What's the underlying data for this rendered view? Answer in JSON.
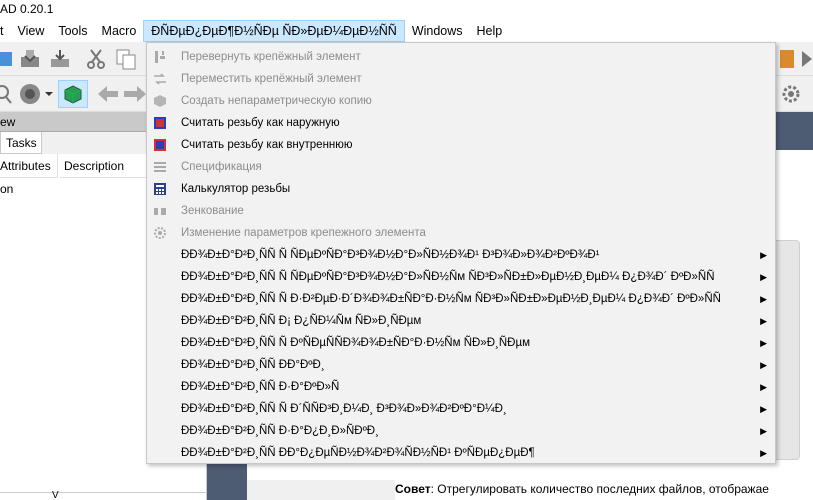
{
  "window": {
    "title": "AD 0.20.1"
  },
  "menubar": {
    "items": [
      {
        "label": "t"
      },
      {
        "label": "View"
      },
      {
        "label": "Tools"
      },
      {
        "label": "Macro"
      },
      {
        "label": "ÐÑÐµÐ¿ÐµÐ¶Ð½ÑÐµ ÑÐ»ÐµÐ¼ÐµÐ½ÑÑ",
        "active": true
      },
      {
        "label": "Windows"
      },
      {
        "label": "Help"
      }
    ]
  },
  "left_panel": {
    "header": "ew",
    "tab": "Tasks",
    "columns": [
      "Attributes",
      "Description"
    ],
    "row1": "on",
    "bottom_col": "V"
  },
  "dropdown": {
    "items": [
      {
        "label": "Перевернуть крепёжный элемент",
        "disabled": true,
        "icon": "flip-icon"
      },
      {
        "label": "Переместить крепёжный элемент",
        "disabled": true,
        "icon": "move-icon"
      },
      {
        "label": "Создать непараметрическую копию",
        "disabled": true,
        "icon": "copy-icon"
      },
      {
        "label": "Считать резьбу как наружную",
        "disabled": false,
        "icon": "thread-outer-icon"
      },
      {
        "label": "Считать резьбу как внутреннюю",
        "disabled": false,
        "icon": "thread-inner-icon"
      },
      {
        "label": "Спецификация",
        "disabled": true,
        "icon": "list-icon"
      },
      {
        "label": "Калькулятор резьбы",
        "disabled": false,
        "icon": "calculator-icon"
      },
      {
        "label": "Зенкование",
        "disabled": true,
        "icon": "countersink-icon"
      },
      {
        "label": "Изменение параметров крепежного элемента",
        "disabled": true,
        "icon": "gear-icon"
      },
      {
        "label": "ÐÐ¾Ð±Ð°Ð²Ð¸ÑÑ Ñ ÑÐµÐºÑÐ°Ð³Ð¾Ð½Ð°Ð»ÑÐ½Ð¾Ð¹ Ð³Ð¾Ð»Ð¾Ð²ÐºÐ¾Ð¹",
        "submenu": true
      },
      {
        "label": "ÐÐ¾Ð±Ð°Ð²Ð¸ÑÑ Ñ ÑÐµÐºÑÐ°Ð³Ð¾Ð½Ð°Ð»ÑÐ½Ñм ÑÐ³Ð»ÑÐ±Ð»ÐµÐ½Ð¸ÐµÐ¼ Ð¿Ð¾Ð´ ÐºÐ»ÑÑ",
        "submenu": true
      },
      {
        "label": "ÐÐ¾Ð±Ð°Ð²Ð¸ÑÑ Ñ Ð·Ð²ÐµÐ·Ð´Ð¾Ð¾Ð±ÑÐ°Ð·Ð½Ñм ÑÐ³Ð»ÑÐ±Ð»ÐµÐ½Ð¸ÐµÐ¼ Ð¿Ð¾Ð´ ÐºÐ»ÑÑ",
        "submenu": true
      },
      {
        "label": "ÐÐ¾Ð±Ð°Ð²Ð¸ÑÑ Ð¡ Ð¿ÑÐ¼Ñм ÑÐ»Ð¸ÑÐµм",
        "submenu": true
      },
      {
        "label": "ÐÐ¾Ð±Ð°Ð²Ð¸ÑÑ Ñ ÐºÑÐµÑÑÐ¾Ð¾Ð±ÑÐ°Ð·Ð½Ñм ÑÐ»Ð¸ÑÐµм",
        "submenu": true
      },
      {
        "label": "ÐÐ¾Ð±Ð°Ð²Ð¸ÑÑ ÐÐ°ÐºÐ¸",
        "submenu": true
      },
      {
        "label": "ÐÐ¾Ð±Ð°Ð²Ð¸ÑÑ Ð·Ð°ÐºÐ»Ñ",
        "submenu": true
      },
      {
        "label": "ÐÐ¾Ð±Ð°Ð²Ð¸ÑÑ Ñ Ð´ÑÑÐ³Ð¸Ð¼Ð¸ Ð³Ð¾Ð»Ð¾Ð²ÐºÐ°Ð¼Ð¸",
        "submenu": true
      },
      {
        "label": "ÐÐ¾Ð±Ð°Ð²Ð¸ÑÑ Ð·Ð°Ð¿Ð¸Ð»ÑÐºÐ¸",
        "submenu": true
      },
      {
        "label": "ÐÐ¾Ð±Ð°Ð²Ð¸ÑÑ ÐÐ°Ð¿ÐµÑÐ½Ð¾Ð²Ð¾ÑÐ½ÑÐ¹ ÐºÑÐµÐ¿ÐµÐ¶",
        "submenu": true
      }
    ]
  },
  "status": {
    "bold": "Совет",
    "text": ": Отрегулировать количество последних файлов, отображае"
  },
  "colors": {
    "menu_active_bg": "#cce8ff",
    "dark_pane": "#4d5b73"
  }
}
